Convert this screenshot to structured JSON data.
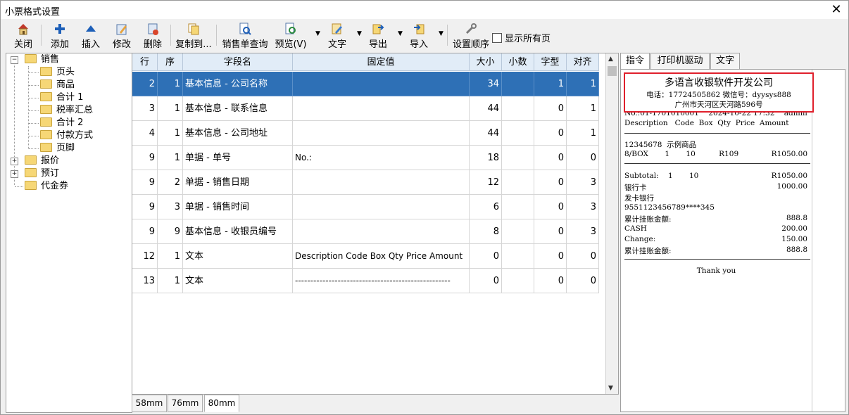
{
  "window": {
    "title": "小票格式设置",
    "close_glyph": "✕"
  },
  "toolbar": {
    "close": "关闭",
    "add": "添加",
    "insert": "插入",
    "edit": "修改",
    "delete": "删除",
    "copy_to": "复制到...",
    "sales_query": "销售单查询",
    "preview": "预览(V)",
    "text": "文字",
    "export": "导出",
    "import": "导入",
    "set_order": "设置顺序",
    "show_all_pages": "显示所有页"
  },
  "tree": {
    "sales": "销售",
    "header": "页头",
    "goods": "商品",
    "total1": "合计 1",
    "tax_summary": "税率汇总",
    "total2": "合计 2",
    "payment": "付款方式",
    "footer": "页脚",
    "quote": "报价",
    "order": "预订",
    "voucher": "代金券"
  },
  "grid": {
    "columns": [
      "行",
      "序",
      "字段名",
      "固定值",
      "大小",
      "小数",
      "字型",
      "对齐"
    ],
    "rows": [
      {
        "row": "2",
        "seq": "1",
        "field": "基本信息 - 公司名称",
        "fixed": "",
        "size": "34",
        "dec": "",
        "font": "1",
        "align": "1"
      },
      {
        "row": "3",
        "seq": "1",
        "field": "基本信息 - 联系信息",
        "fixed": "",
        "size": "44",
        "dec": "",
        "font": "0",
        "align": "1"
      },
      {
        "row": "4",
        "seq": "1",
        "field": "基本信息 - 公司地址",
        "fixed": "",
        "size": "44",
        "dec": "",
        "font": "0",
        "align": "1"
      },
      {
        "row": "9",
        "seq": "1",
        "field": "单据 - 单号",
        "fixed": "No.:",
        "size": "18",
        "dec": "",
        "font": "0",
        "align": "0"
      },
      {
        "row": "9",
        "seq": "2",
        "field": "单据 - 销售日期",
        "fixed": "",
        "size": "12",
        "dec": "",
        "font": "0",
        "align": "3"
      },
      {
        "row": "9",
        "seq": "3",
        "field": "单据 - 销售时间",
        "fixed": "",
        "size": "6",
        "dec": "",
        "font": "0",
        "align": "3"
      },
      {
        "row": "9",
        "seq": "9",
        "field": "基本信息 - 收银员编号",
        "fixed": "",
        "size": "8",
        "dec": "",
        "font": "0",
        "align": "3"
      },
      {
        "row": "12",
        "seq": "1",
        "field": "文本",
        "fixed": "Description  Code Box  Qty  Price  Amount",
        "size": "0",
        "dec": "",
        "font": "0",
        "align": "0"
      },
      {
        "row": "13",
        "seq": "1",
        "field": "文本",
        "fixed": "---------------------------------------------------",
        "size": "0",
        "dec": "",
        "font": "0",
        "align": "0"
      }
    ]
  },
  "paper_tabs": [
    "58mm",
    "76mm",
    "80mm"
  ],
  "right_tabs": [
    "指令",
    "打印机驱动",
    "文字"
  ],
  "receipt": {
    "company": "多语言收银软件开发公司",
    "contact": "电话：17724505862   微信号：dyysys888",
    "address": "广州市天河区天河路596号",
    "docline": "No.:01-1701010001    2024-10-22 17:32    admin",
    "header_cols": "Description   Code  Box  Qty  Price  Amount",
    "item_code": "12345678  示例商品",
    "item_line_left": "8/BOX       1       10          R109",
    "item_line_right": "R1050.00",
    "subtotal_left": "Subtotal:    1       10",
    "subtotal_right": "R1050.00",
    "bank_card": "银行卡",
    "bank_card_amount": "1000.00",
    "issuer": "发卡银行",
    "card_no": "9551123456789****345",
    "credit_total": "累计挂账金额:",
    "credit_total_amount": "888.8",
    "cash": "CASH",
    "cash_amount": "200.00",
    "change": "Change:",
    "change_amount": "150.00",
    "credit_total2": "累计挂账金额:",
    "credit_total2_amount": "888.8",
    "thanks": "Thank you"
  },
  "colors": {
    "selection": "#2e70b6",
    "highlight_box": "#e0202c",
    "header_bg": "#e1ecf7"
  }
}
